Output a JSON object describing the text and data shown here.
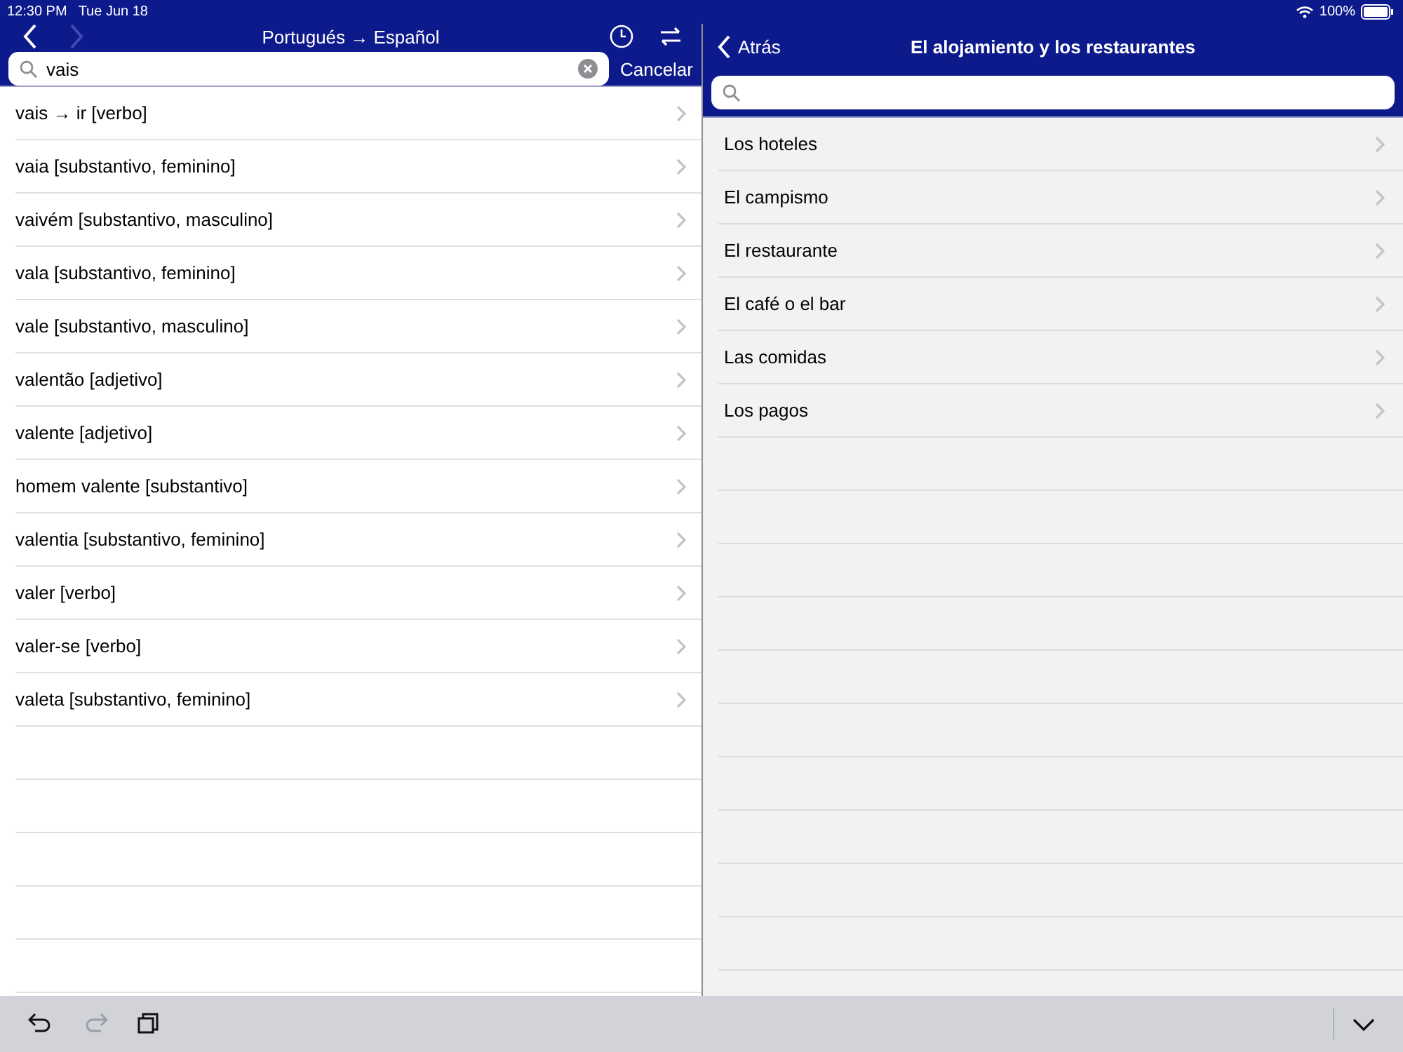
{
  "status_bar": {
    "time": "12:30 PM",
    "date": "Tue Jun 18",
    "battery": "100%"
  },
  "left_pane": {
    "title": "Portugués → Español",
    "nav_buttons": [
      {
        "kind": "back",
        "disabled": false
      },
      {
        "kind": "forward",
        "disabled": true
      }
    ],
    "search": {
      "value": "vais"
    },
    "cancel": "Cancelar",
    "results": [
      {
        "label": "vais → ir [verbo]"
      },
      {
        "label": "vaia [substantivo, feminino]"
      },
      {
        "label": "vaivém [substantivo, masculino]"
      },
      {
        "label": "vala [substantivo, feminino]"
      },
      {
        "label": "vale [substantivo, masculino]"
      },
      {
        "label": "valentão [adjetivo]"
      },
      {
        "label": "valente [adjetivo]"
      },
      {
        "label": "homem valente [substantivo]"
      },
      {
        "label": "valentia [substantivo, feminino]"
      },
      {
        "label": "valer [verbo]"
      },
      {
        "label": "valer-se [verbo]"
      },
      {
        "label": "valeta [substantivo, feminino]"
      }
    ]
  },
  "right_pane": {
    "back": "Atrás",
    "title": "El alojamiento y los restaurantes",
    "items": [
      {
        "label": "Los hoteles"
      },
      {
        "label": "El campismo"
      },
      {
        "label": "El restaurante"
      },
      {
        "label": "El café o el bar"
      },
      {
        "label": "Las comidas"
      },
      {
        "label": "Los pagos"
      }
    ]
  },
  "toolbar": {
    "buttons": [
      {
        "kind": "undo",
        "disabled": false
      },
      {
        "kind": "redo",
        "disabled": true
      },
      {
        "kind": "copy",
        "disabled": false
      },
      {
        "kind": "collapse",
        "disabled": false
      }
    ]
  }
}
